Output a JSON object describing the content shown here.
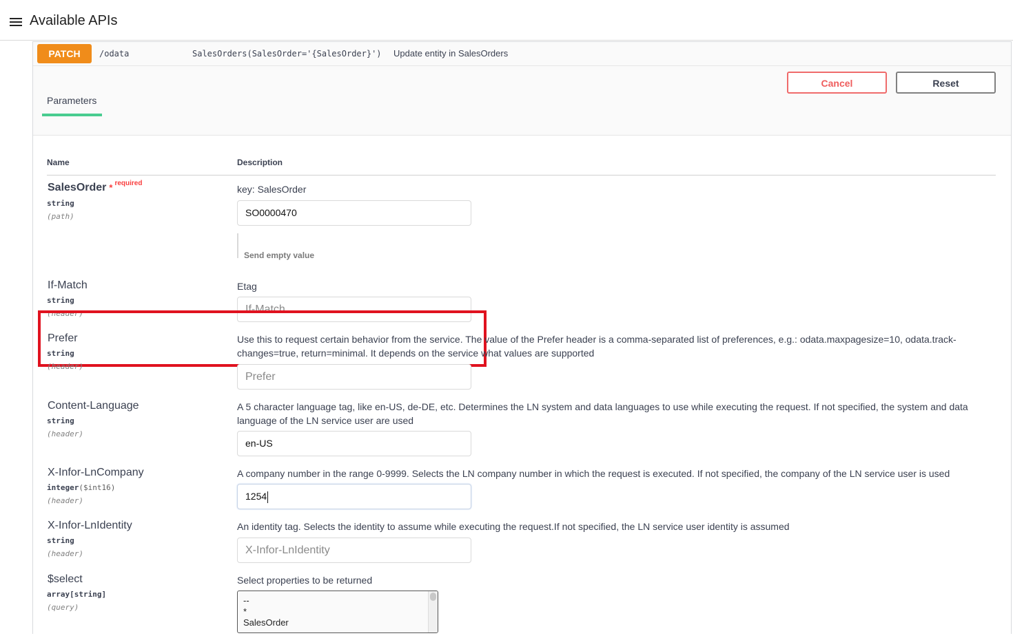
{
  "header": {
    "title": "Available APIs"
  },
  "operation": {
    "method": "PATCH",
    "path_base": "/odata",
    "path_entity": "SalesOrders(SalesOrder='{SalesOrder}')",
    "description": "Update entity in SalesOrders",
    "cancel_label": "Cancel",
    "reset_label": "Reset",
    "tab_label": "Parameters"
  },
  "table": {
    "col_name": "Name",
    "col_description": "Description"
  },
  "params": [
    {
      "name": "SalesOrder",
      "required_star": "*",
      "required_text": "required",
      "type": "string",
      "in": "(path)",
      "description": "key: SalesOrder",
      "value": "SO0000470",
      "send_empty": "Send empty value"
    },
    {
      "name": "If-Match",
      "type": "string",
      "in": "(header)",
      "description": "Etag",
      "placeholder": "If-Match"
    },
    {
      "name": "Prefer",
      "type": "string",
      "in": "(header)",
      "description_line1": "Use this to request certain behavior from the service. The value of the Prefer header is a comma-separated list of preferences, e.g.: odata.maxpagesize=10, odata.track-",
      "description_line2": "changes=true, return=minimal. It depends on the service what values are supported",
      "placeholder": "Prefer"
    },
    {
      "name": "Content-Language",
      "type": "string",
      "in": "(header)",
      "description_line1": "A 5 character language tag, like en-US, de-DE, etc. Determines the LN system and data languages to use while executing the request. If not specified, the system and data",
      "description_line2": "language of the LN service user are used",
      "value": "en-US"
    },
    {
      "name": "X-Infor-LnCompany",
      "type": "integer",
      "format": "($int16)",
      "in": "(header)",
      "description": "A company number in the range 0-9999. Selects the LN company number in which the request is executed. If not specified, the company of the LN service user is used",
      "value": "1254"
    },
    {
      "name": "X-Infor-LnIdentity",
      "type": "string",
      "in": "(header)",
      "description": "An identity tag. Selects the identity to assume while executing the request.If not specified, the LN service user identity is assumed",
      "placeholder": "X-Infor-LnIdentity"
    },
    {
      "name": "$select",
      "type": "array[string]",
      "in": "(query)",
      "description": "Select properties to be returned",
      "options": [
        "--",
        "*",
        "SalesOrder"
      ]
    }
  ],
  "colors": {
    "patch": "#f08c1a",
    "cancel": "#ef5c5c",
    "tab_underline": "#49cc90",
    "highlight": "#e0121f"
  }
}
